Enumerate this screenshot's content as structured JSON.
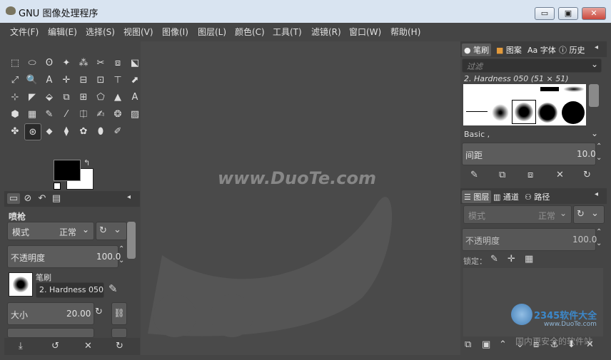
{
  "window": {
    "title": "GNU 图像处理程序",
    "btn_min": "▭",
    "btn_max": "▣",
    "btn_close": "✕"
  },
  "menus": [
    "文件(F)",
    "编辑(E)",
    "选择(S)",
    "视图(V)",
    "图像(I)",
    "图层(L)",
    "颜色(C)",
    "工具(T)",
    "滤镜(R)",
    "窗口(W)",
    "帮助(H)"
  ],
  "tools": [
    "⬚",
    "⬭",
    "ʘ",
    "✦",
    "⁂",
    "✂",
    "⧈",
    "⬕",
    "⤢",
    "🔍",
    "A",
    "✛",
    "⊟",
    "⊡",
    "⊤",
    "⬈",
    "⊹",
    "◤",
    "⬙",
    "⧉",
    "⊞",
    "⬠",
    "▲",
    "A",
    "⬢",
    "▦",
    "✎",
    "⁄",
    "⎅",
    "✍",
    "❂",
    "▨",
    "✤",
    "⊛",
    "⬥",
    "⧫",
    "✿",
    "⬮",
    "✐"
  ],
  "tool_options": {
    "tabs": [
      "▭",
      "⊘",
      "↶",
      "▤"
    ],
    "title": "喷枪",
    "mode_label": "模式",
    "mode_value": "正常",
    "opacity_label": "不透明度",
    "opacity_value": "100.0",
    "brush_label": "笔刷",
    "brush_value": "2. Hardness 050",
    "size_label": "大小",
    "size_value": "20.00",
    "bottom": [
      "⤓",
      "↺",
      "✕",
      "↻"
    ]
  },
  "canvas": {
    "watermark": "www.DuoTe.com"
  },
  "brushes": {
    "tabs": [
      "笔刷",
      "图案",
      "字体",
      "历史"
    ],
    "filter_placeholder": "过滤",
    "selected": "2. Hardness 050 (51 × 51)",
    "tag": "Basic ,",
    "spacing_label": "间距",
    "spacing_value": "10.0",
    "actions": [
      "✎",
      "⧉",
      "⧈",
      "✕",
      "↻"
    ]
  },
  "layers": {
    "tabs": [
      "图层",
      "通道",
      "路径"
    ],
    "mode_label": "模式",
    "mode_value": "正常",
    "opacity_label": "不透明度",
    "opacity_value": "100.0",
    "lock_label": "锁定：",
    "lock_icons": [
      "✎",
      "✛",
      "▦"
    ],
    "actions": [
      "⧉",
      "▣",
      "⌃",
      "⌄",
      "⧈",
      "⚓",
      "⬇",
      "✕"
    ]
  },
  "overlay": {
    "brand": "2345软件大全",
    "url": "www.DuoTe.com",
    "caption": "国内更安全的软件站"
  }
}
